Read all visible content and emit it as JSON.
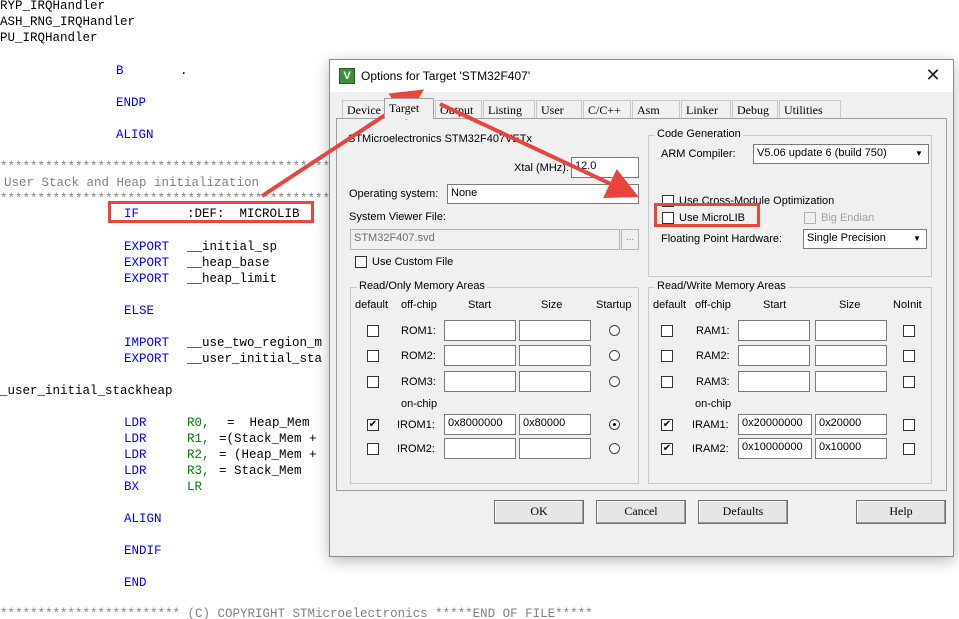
{
  "editor": {
    "lines": [
      {
        "text": "RYP_IRQHandler"
      },
      {
        "text": "ASH_RNG_IRQHandler"
      },
      {
        "text": "PU_IRQHandler"
      }
    ],
    "b_line": {
      "op": "B",
      "arg": "."
    },
    "endp": "ENDP",
    "align1": "ALIGN",
    "stars1": "**********************************************",
    "comment": "User Stack and Heap initialization",
    "stars2": "**********************************************",
    "if_line": {
      "op": "IF",
      "arg": ":DEF:  MICROLIB"
    },
    "exports": [
      {
        "op": "EXPORT",
        "arg": "__initial_sp"
      },
      {
        "op": "EXPORT",
        "arg": "__heap_base"
      },
      {
        "op": "EXPORT",
        "arg": "__heap_limit"
      }
    ],
    "else": "ELSE",
    "import": {
      "op": "IMPORT",
      "arg": "__use_two_region_m"
    },
    "export_user": {
      "op": "EXPORT",
      "arg": "__user_initial_sta"
    },
    "label": "_user_initial_stackheap",
    "ldr": [
      {
        "op": "LDR",
        "reg": "R0,",
        "arg": "=  Heap_Mem"
      },
      {
        "op": "LDR",
        "reg": "R1,",
        "arg": "=(Stack_Mem +"
      },
      {
        "op": "LDR",
        "reg": "R2,",
        "arg": "= (Heap_Mem +"
      },
      {
        "op": "LDR",
        "reg": "R3,",
        "arg": "= Stack_Mem"
      }
    ],
    "bx": {
      "op": "BX",
      "arg": "LR"
    },
    "align2": "ALIGN",
    "endif": "ENDIF",
    "end": "END",
    "footer": "************************ (C) COPYRIGHT STMicroelectronics *****END OF FILE*****"
  },
  "dialog": {
    "title": "Options for Target 'STM32F407'",
    "tabs": [
      "Device",
      "Target",
      "Output",
      "Listing",
      "User",
      "C/C++",
      "Asm",
      "Linker",
      "Debug",
      "Utilities"
    ],
    "active_tab": "Target",
    "device_name": "STMicroelectronics STM32F407VETx",
    "xtal_label": "Xtal (MHz):",
    "xtal_value": "12.0",
    "os_label": "Operating system:",
    "os_value": "None",
    "svf_label": "System Viewer File:",
    "svf_value": "STM32F407.svd",
    "use_custom_file": "Use Custom File",
    "code_gen": {
      "title": "Code Generation",
      "compiler_label": "ARM Compiler:",
      "compiler_value": "V5.06 update 6 (build 750)",
      "cross_module": "Use Cross-Module Optimization",
      "microlib": "Use MicroLIB",
      "big_endian": "Big Endian",
      "fpu_label": "Floating Point Hardware:",
      "fpu_value": "Single Precision"
    },
    "ro_mem": {
      "title": "Read/Only Memory Areas",
      "headers": [
        "default",
        "off-chip",
        "Start",
        "Size",
        "Startup"
      ],
      "onchip_label": "on-chip",
      "rows": [
        {
          "name": "ROM1:",
          "start": "",
          "size": "",
          "default": false,
          "startup": false
        },
        {
          "name": "ROM2:",
          "start": "",
          "size": "",
          "default": false,
          "startup": false
        },
        {
          "name": "ROM3:",
          "start": "",
          "size": "",
          "default": false,
          "startup": false
        },
        {
          "name": "IROM1:",
          "start": "0x8000000",
          "size": "0x80000",
          "default": true,
          "startup": true
        },
        {
          "name": "IROM2:",
          "start": "",
          "size": "",
          "default": false,
          "startup": false
        }
      ]
    },
    "rw_mem": {
      "title": "Read/Write Memory Areas",
      "headers": [
        "default",
        "off-chip",
        "Start",
        "Size",
        "NoInit"
      ],
      "onchip_label": "on-chip",
      "rows": [
        {
          "name": "RAM1:",
          "start": "",
          "size": "",
          "default": false,
          "noinit": false
        },
        {
          "name": "RAM2:",
          "start": "",
          "size": "",
          "default": false,
          "noinit": false
        },
        {
          "name": "RAM3:",
          "start": "",
          "size": "",
          "default": false,
          "noinit": false
        },
        {
          "name": "IRAM1:",
          "start": "0x20000000",
          "size": "0x20000",
          "default": true,
          "noinit": false
        },
        {
          "name": "IRAM2:",
          "start": "0x10000000",
          "size": "0x10000",
          "default": true,
          "noinit": false
        }
      ]
    },
    "buttons": {
      "ok": "OK",
      "cancel": "Cancel",
      "defaults": "Defaults",
      "help": "Help"
    }
  },
  "annotation_color": "#e8453c"
}
